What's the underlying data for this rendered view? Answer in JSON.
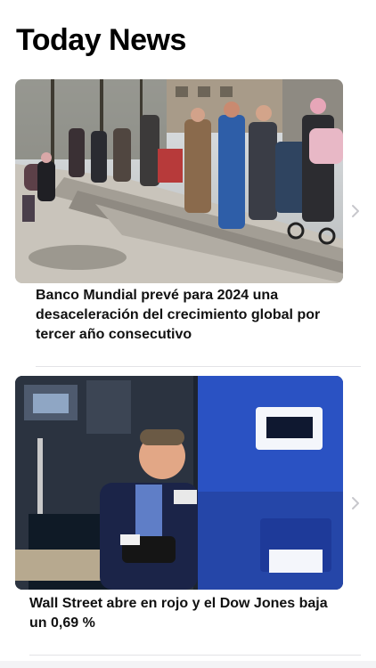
{
  "page": {
    "title": "Today News"
  },
  "articles": [
    {
      "headline": "Banco Mundial prevé para 2024 una desaceleración del crecimiento global por tercer año consecutivo",
      "image": "people queuing on a street sidewalk with shopping carts"
    },
    {
      "headline": "Wall Street abre en rojo y el Dow Jones baja un 0,69 %",
      "image": "trader on the New York Stock Exchange floor"
    }
  ],
  "icons": {
    "chevron": "chevron-right-icon"
  },
  "colors": {
    "background": "#ffffff",
    "text": "#111111",
    "divider": "#e3e3e6",
    "chevron": "#c7c7cc"
  }
}
